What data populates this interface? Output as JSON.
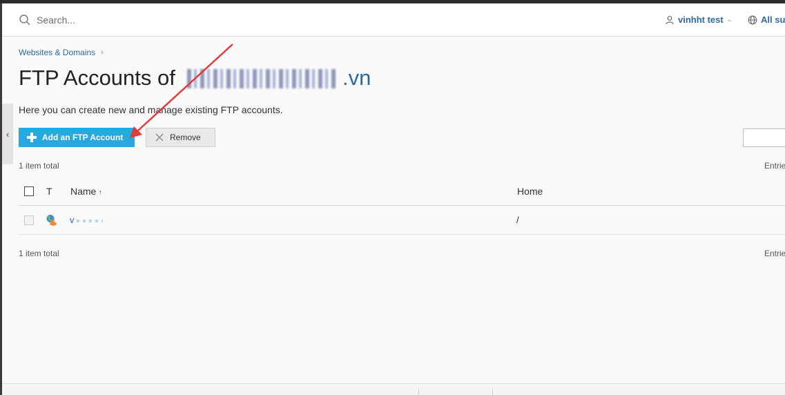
{
  "header": {
    "search_placeholder": "Search...",
    "user_name": "vinhht test",
    "subscriptions_label": "All sub"
  },
  "breadcrumb": {
    "item": "Websites & Domains"
  },
  "page": {
    "title_prefix": "FTP Accounts of",
    "domain_tld": ".vn",
    "description": "Here you can create new and manage existing FTP accounts."
  },
  "toolbar": {
    "add_label": "Add an FTP Account",
    "remove_label": "Remove"
  },
  "list": {
    "count_top": "1 item total",
    "count_bottom": "1 item total",
    "entries_top": "Entrie",
    "entries_bottom": "Entrie",
    "columns": {
      "type": "T",
      "name": "Name",
      "home": "Home"
    },
    "rows": [
      {
        "name": "v",
        "home": "/"
      }
    ]
  },
  "colors": {
    "accent": "#28a8e0",
    "link": "#2a6aa3",
    "annotation_arrow": "#e53935"
  },
  "icons": {
    "search": "search-icon",
    "user": "user-icon",
    "globe": "globe-icon",
    "plus": "plus-icon",
    "remove": "x-icon",
    "row_type": "ftp-user-icon",
    "collapse": "chevron-left-icon"
  }
}
